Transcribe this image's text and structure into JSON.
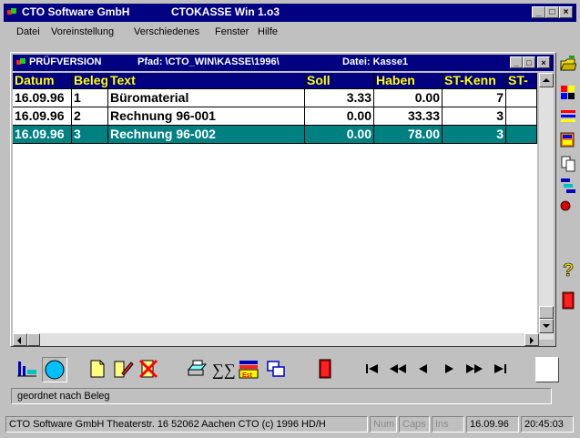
{
  "window": {
    "company": "CTO Software GmbH",
    "title": "CTOKASSE Win 1.o3",
    "buttons": [
      "_",
      "□",
      "×"
    ]
  },
  "menu": [
    "Datei",
    "Voreinstellung",
    "Verschiedenes",
    "Fenster",
    "Hilfe"
  ],
  "child": {
    "version": "PRÜFVERSION",
    "path": "Pfad: \\CTO_WIN\\KASSE\\1996\\",
    "file": "Datei: Kasse1"
  },
  "table": {
    "columns": [
      "Datum",
      "Beleg",
      "Text",
      "Soll",
      "Haben",
      "ST-Kenn",
      "ST-"
    ],
    "rows": [
      {
        "datum": "16.09.96",
        "beleg": "1",
        "text": "Büromaterial",
        "soll": "3.33",
        "haben": "0.00",
        "st": "7",
        "st2": "",
        "selected": false
      },
      {
        "datum": "16.09.96",
        "beleg": "2",
        "text": "Rechnung 96-001",
        "soll": "0.00",
        "haben": "33.33",
        "st": "3",
        "st2": "",
        "selected": false
      },
      {
        "datum": "16.09.96",
        "beleg": "3",
        "text": "Rechnung 96-002",
        "soll": "0.00",
        "haben": "78.00",
        "st": "3",
        "st2": "",
        "selected": true
      }
    ]
  },
  "hint": "geordnet nach Beleg",
  "status": {
    "info": "CTO Software GmbH Theaterstr. 16 52062 Aachen CTO (c) 1996 HD/H",
    "num": "Num",
    "caps": "Caps",
    "ins": "Ins",
    "date": "16.09.96",
    "time": "20:45:03"
  },
  "colors": {
    "titlebar": "#000080",
    "header_text": "#ffff00",
    "selection": "#008080"
  }
}
